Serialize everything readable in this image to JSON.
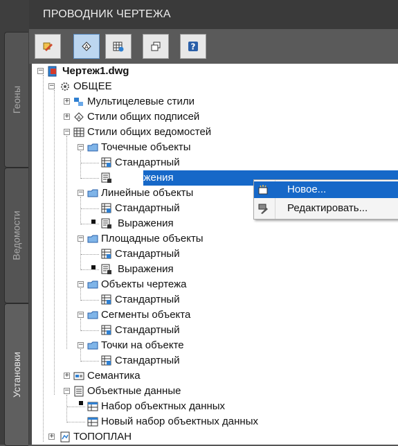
{
  "panel": {
    "title": "ПРОВОДНИК ЧЕРТЕЖА"
  },
  "side_tabs": [
    {
      "label": "Геоны"
    },
    {
      "label": "Ведомости"
    },
    {
      "label": "Установки"
    }
  ],
  "toolbar": {
    "buttons": [
      {
        "icon": "edit-style-icon",
        "active": false
      },
      {
        "icon": "label-style-icon",
        "active": true
      },
      {
        "icon": "table-style-icon",
        "active": false
      },
      {
        "icon": "duplicate-icon",
        "active": false
      },
      {
        "icon": "help-icon",
        "active": false
      }
    ]
  },
  "tree": {
    "root": "Чертеж1.dwg",
    "general": "ОБЩЕЕ",
    "multileader_styles": "Мультицелевые стили",
    "label_styles": "Стили общих подписей",
    "table_styles": "Стили общих ведомостей",
    "point_objects": "Точечные объекты",
    "point_standard": "Стандартный",
    "point_expressions": "Выражения",
    "line_objects": "Линейные объекты",
    "line_standard": "Стандартный",
    "line_expressions": "Выражения",
    "area_objects": "Площадные объекты",
    "area_standard": "Стандартный",
    "area_expressions": "Выражения",
    "drawing_objects": "Объекты чертежа",
    "drawing_standard": "Стандартный",
    "segment_objects": "Сегменты объекта",
    "segment_standard": "Стандартный",
    "object_points": "Точки на объекте",
    "object_points_standard": "Стандартный",
    "semantics": "Семантика",
    "object_data": "Объектные данные",
    "object_data_set": "Набор объектных данных",
    "new_object_data_set": "Новый набор объектных данных",
    "topoplan": "ТОПОПЛАН"
  },
  "context_menu": {
    "new": "Новое...",
    "edit": "Редактировать..."
  },
  "colors": {
    "selection": "#1668c8",
    "panel_bg": "#3a3a3a"
  }
}
